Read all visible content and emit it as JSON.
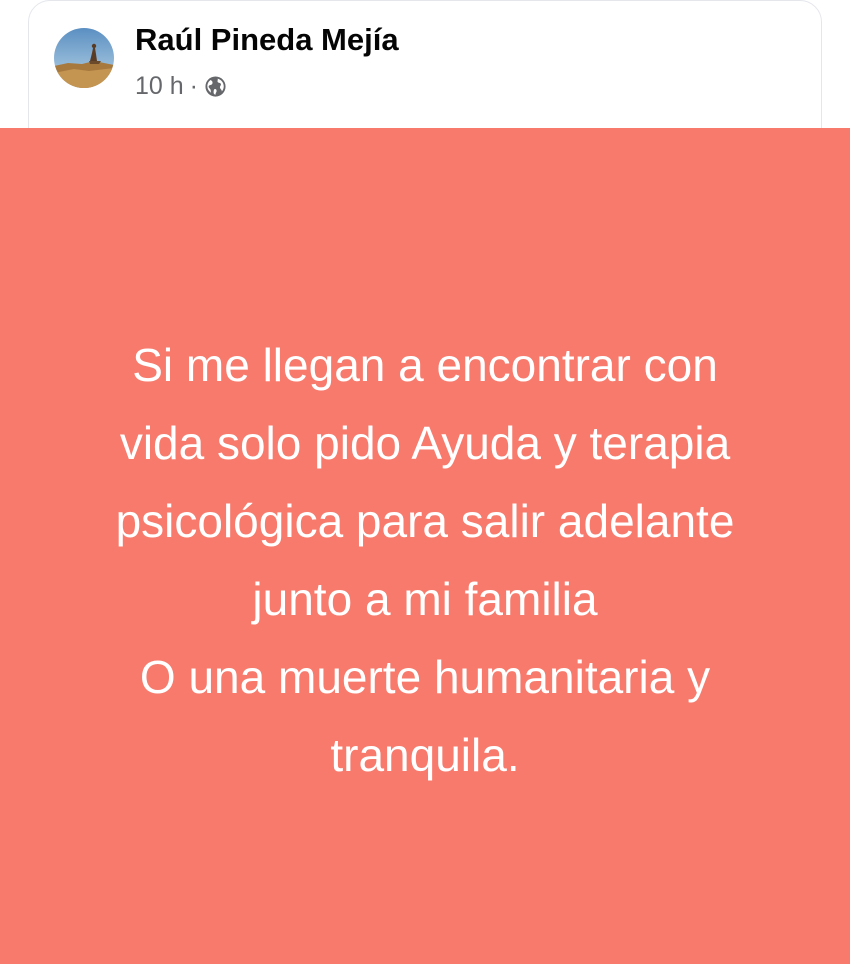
{
  "post": {
    "author": "Raúl Pineda Mejía",
    "time": "10 h",
    "separator": "·",
    "privacy_icon": "globe-icon",
    "avatar_icon": "profile-landscape-avatar",
    "background_color": "#f77a6c",
    "text_color": "#ffffff",
    "text_lines": [
      "Si me llegan a encontrar con",
      "vida solo pido Ayuda y terapia",
      "psicológica para salir adelante",
      "junto a mi familia",
      "O una muerte humanitaria y",
      "tranquila."
    ]
  }
}
